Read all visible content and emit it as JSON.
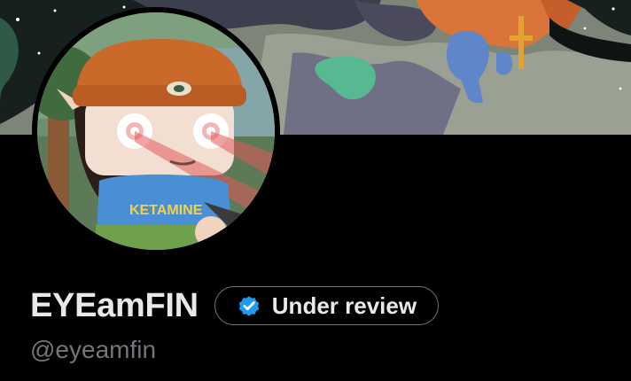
{
  "profile": {
    "display_name": "EYEamFIN",
    "handle": "@eyeamfin",
    "review_pill": {
      "label": "Under review",
      "icon": "verified-badge-icon"
    },
    "avatar_shirt_text": "KETAMINE"
  },
  "colors": {
    "background": "#000000",
    "primary_text": "#e7e9ea",
    "secondary_text": "#71767b",
    "pill_border": "#71767b",
    "verified_blue": "#1d9bf0"
  }
}
